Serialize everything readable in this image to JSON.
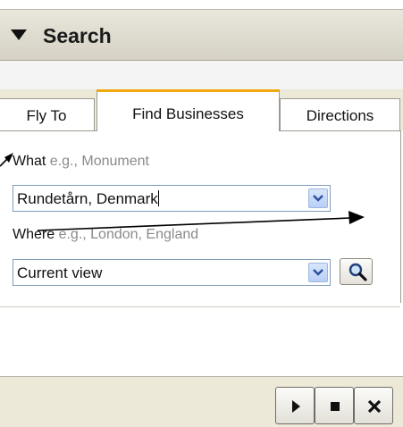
{
  "panel": {
    "title": "Search",
    "tabs": [
      {
        "label": "Fly To"
      },
      {
        "label": "Find Businesses"
      },
      {
        "label": "Directions"
      }
    ],
    "active_tab": "Find Businesses"
  },
  "what": {
    "label": "What",
    "hint": " e.g., Monument",
    "value": "Rundetårn, Denmark"
  },
  "where": {
    "label": "Where",
    "hint": " e.g., London, England",
    "value": "Current view"
  },
  "colors": {
    "active_tab_accent": "#f2a80f",
    "header_bg": "#dcd8cc",
    "footer_bg": "#ece9d8"
  },
  "icons": {
    "collapse": "triangle-down-icon",
    "dropdown": "chevron-down-icon",
    "search": "magnifier-icon",
    "play": "play-icon",
    "stop": "stop-icon",
    "close": "close-icon"
  }
}
